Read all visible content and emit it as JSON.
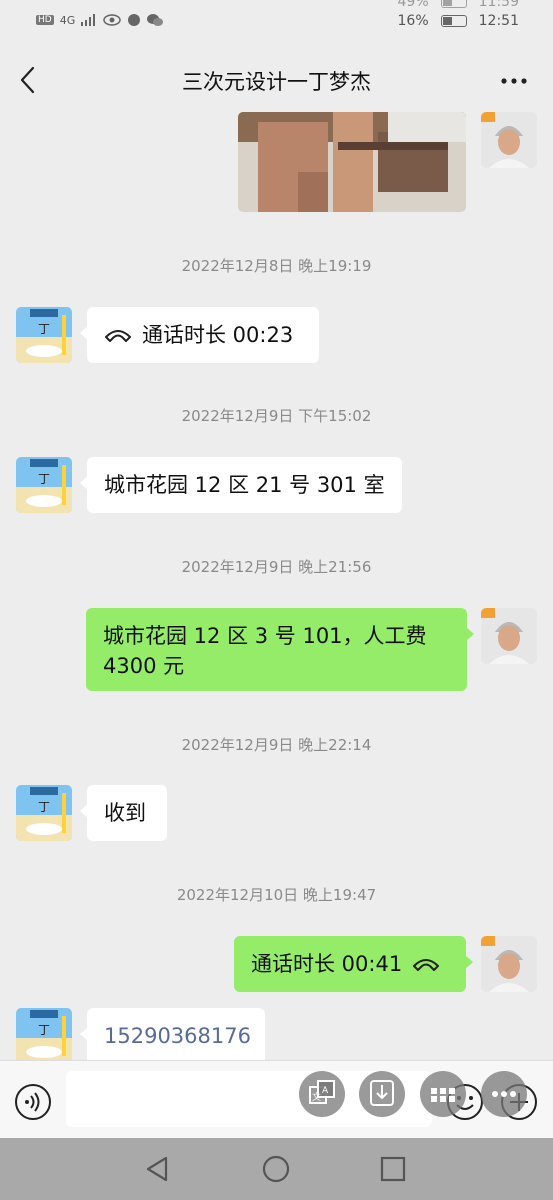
{
  "status_bar": {
    "row1": {
      "battery": "49%",
      "time": "11:59"
    },
    "row2": {
      "hd": "HD",
      "net": "4G",
      "battery": "16%",
      "time": "12:51"
    }
  },
  "header": {
    "title": "三次元设计一丁梦杰",
    "back_icon": "chevron-left-icon",
    "more_icon": "more-dots-icon"
  },
  "messages": {
    "ts1": "2022年12月8日 晚上19:19",
    "call1": "通话时长 00:23",
    "ts2": "2022年12月9日 下午15:02",
    "msg_address1": "城市花园 12 区 21 号 301 室",
    "ts3": "2022年12月9日 晚上21:56",
    "msg_address2": "城市花园 12 区 3 号 101，人工费 4300 元",
    "ts4": "2022年12月9日 晚上22:14",
    "msg_received": "收到",
    "ts5": "2022年12月10日 晚上19:47",
    "call2": "通话时长 00:41",
    "msg_phone": "15290368176"
  },
  "input_bar": {
    "placeholder": "",
    "icons": [
      "voice-icon",
      "translate-icon",
      "download-icon",
      "grid-icon",
      "emoji-icon",
      "more-icon",
      "plus-icon"
    ]
  },
  "colors": {
    "background": "#ededed",
    "bubble_sent": "#95ec69",
    "bubble_received": "#ffffff",
    "link": "#576b95"
  }
}
